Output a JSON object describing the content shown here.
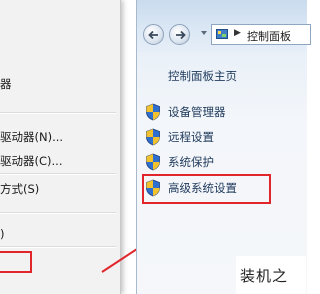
{
  "context_menu": {
    "items": [
      {
        "label": "器"
      },
      {
        "label": "驱动器(N)..."
      },
      {
        "label": "驱动器(C)..."
      },
      {
        "label": "方式(S)"
      },
      {
        "label": ")"
      }
    ]
  },
  "control_panel": {
    "address": {
      "icon": "control-panel-icon",
      "text": "控制面板"
    },
    "home_link": "控制面板主页",
    "links": [
      {
        "label": "设备管理器",
        "icon": "shield-icon"
      },
      {
        "label": "远程设置",
        "icon": "shield-icon"
      },
      {
        "label": "系统保护",
        "icon": "shield-icon"
      },
      {
        "label": "高级系统设置",
        "icon": "shield-icon"
      }
    ]
  },
  "watermark": {
    "text": "装机之"
  },
  "colors": {
    "highlight": "#e0262b",
    "link": "#1e395b"
  }
}
